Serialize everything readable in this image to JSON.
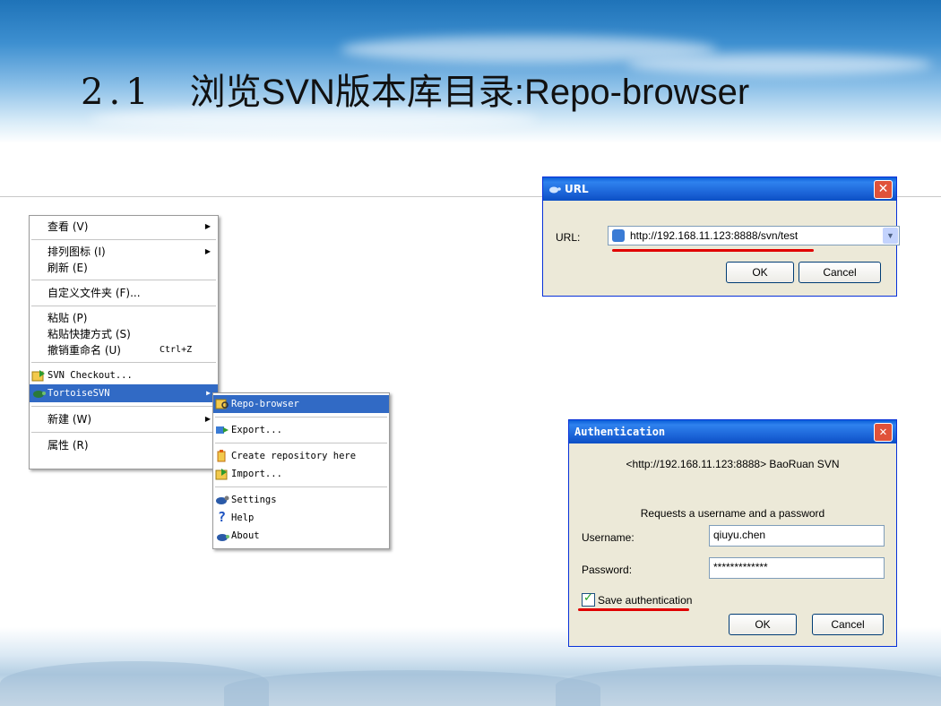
{
  "slide": {
    "title_num": "2.1",
    "title_text": "浏览SVN版本库目录:Repo-browser"
  },
  "explorer_menu": {
    "items": [
      {
        "label": "查看 (V)"
      },
      {
        "label": "排列图标 (I)"
      },
      {
        "label": "刷新 (E)"
      },
      {
        "label": "自定义文件夹 (F)..."
      },
      {
        "label": "粘贴 (P)"
      },
      {
        "label": "粘贴快捷方式 (S)"
      },
      {
        "label": "撤销重命名 (U)",
        "shortcut": "Ctrl+Z"
      },
      {
        "label": "SVN Checkout..."
      },
      {
        "label": "TortoiseSVN"
      },
      {
        "label": "新建 (W)"
      },
      {
        "label": "属性 (R)"
      }
    ]
  },
  "tortoise_menu": {
    "items": [
      {
        "label": "Repo-browser"
      },
      {
        "label": "Export..."
      },
      {
        "label": "Create repository here"
      },
      {
        "label": "Import..."
      },
      {
        "label": "Settings"
      },
      {
        "label": "Help"
      },
      {
        "label": "About"
      }
    ]
  },
  "url_dialog": {
    "title": "URL",
    "url_label": "URL:",
    "url_value": "http://192.168.11.123:8888/svn/test",
    "ok_label": "OK",
    "cancel_label": "Cancel"
  },
  "auth_dialog": {
    "title": "Authentication",
    "realm": "<http://192.168.11.123:8888> BaoRuan SVN",
    "prompt": "Requests a username and a password",
    "username_label": "Username:",
    "username_value": "qiuyu.chen",
    "password_label": "Password:",
    "password_value": "*************",
    "save_label": "Save authentication",
    "save_checked": true,
    "ok_label": "OK",
    "cancel_label": "Cancel"
  },
  "colors": {
    "highlight": "#316ac5",
    "xp_title": "#0a5fd8",
    "underline_mark": "#e00000"
  }
}
